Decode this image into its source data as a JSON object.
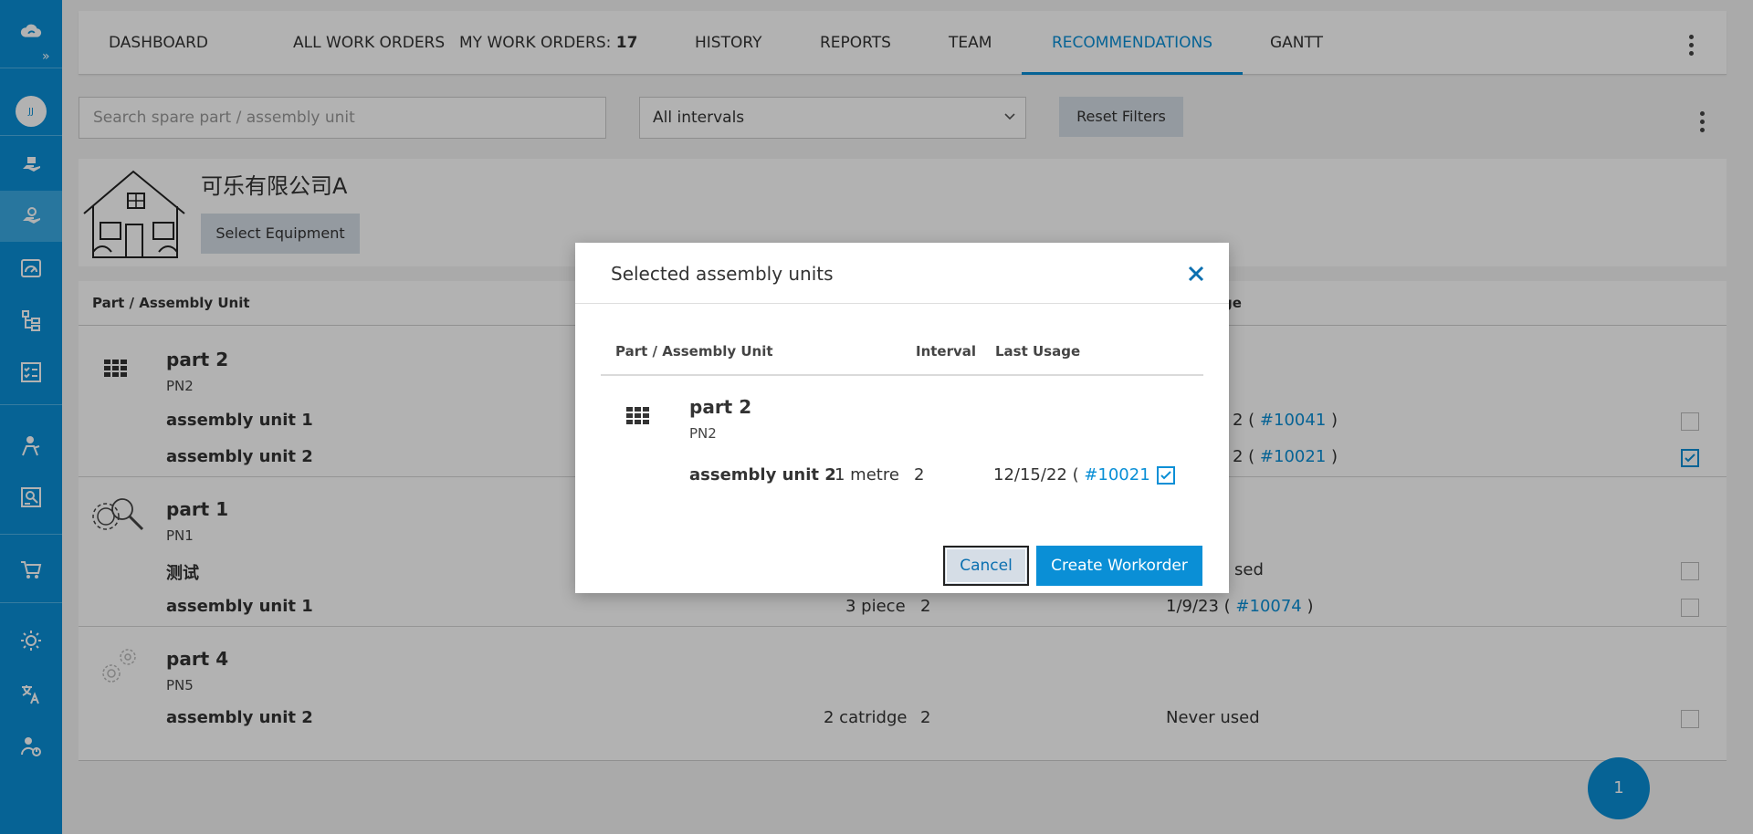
{
  "sidebar": {
    "avatar": "JJ",
    "icons": [
      "cloud-logo-icon",
      "expand-icon",
      "hand-wrench-icon",
      "hand-settings-icon",
      "gauge-icon",
      "hierarchy-icon",
      "checklist-icon",
      "worker-icon",
      "report-icon",
      "cart-icon",
      "brightness-icon",
      "translate-icon",
      "user-power-icon"
    ]
  },
  "tabs": [
    {
      "label": "DASHBOARD"
    },
    {
      "label": "ALL WORK ORDERS"
    },
    {
      "label": "MY WORK ORDERS: ",
      "count": "17"
    },
    {
      "label": "HISTORY"
    },
    {
      "label": "REPORTS"
    },
    {
      "label": "TEAM"
    },
    {
      "label": "RECOMMENDATIONS",
      "active": true
    },
    {
      "label": "GANTT"
    }
  ],
  "filters": {
    "search_placeholder": "Search spare part / assembly unit",
    "interval_selected": "All intervals",
    "reset_label": "Reset Filters"
  },
  "equipment": {
    "company": "可乐有限公司A",
    "select_label": "Select Equipment"
  },
  "table": {
    "header_part": "Part / Assembly Unit",
    "header_last_usage_fragment": "ge",
    "groups": [
      {
        "name": "part 2",
        "pn": "PN2",
        "icon": "grid-icon",
        "rows": [
          {
            "name": "assembly unit 1",
            "usage_prefix": "2 ( ",
            "order": "#10041",
            "usage_suffix": " )",
            "checked": false
          },
          {
            "name": "assembly unit 2",
            "usage_prefix": "2 ( ",
            "order": "#10021",
            "usage_suffix": " )",
            "checked": true
          }
        ]
      },
      {
        "name": "part 1",
        "pn": "PN1",
        "icon": "gear-search-icon",
        "rows": [
          {
            "name": "测试",
            "usage_prefix": "sed",
            "checked": false
          },
          {
            "name": "assembly unit 1",
            "qty": "3 piece",
            "interval": "2",
            "usage_prefix": "1/9/23 ( ",
            "order": "#10074",
            "usage_suffix": " )",
            "checked": false
          }
        ]
      },
      {
        "name": "part 4",
        "pn": "PN5",
        "icon": "gears-icon",
        "rows": [
          {
            "name": "assembly unit 2",
            "qty": "2 catridge",
            "interval": "2",
            "usage_prefix": "Never used",
            "checked": false
          }
        ]
      }
    ]
  },
  "fab_count": "1",
  "modal": {
    "title": "Selected assembly units",
    "col_part": "Part / Assembly Unit",
    "col_interval": "Interval",
    "col_last_usage": "Last Usage",
    "part_name": "part 2",
    "part_no": "PN2",
    "row": {
      "name": "assembly unit 2",
      "qty": "1 metre",
      "interval": "2",
      "usage_prefix": "12/15/22 ( ",
      "order": "#10021",
      "usage_suffix": " )",
      "checked": true
    },
    "cancel_label": "Cancel",
    "create_label": "Create Workorder"
  },
  "colors": {
    "accent": "#0a8fd6",
    "button_gray": "#d5dde6"
  }
}
